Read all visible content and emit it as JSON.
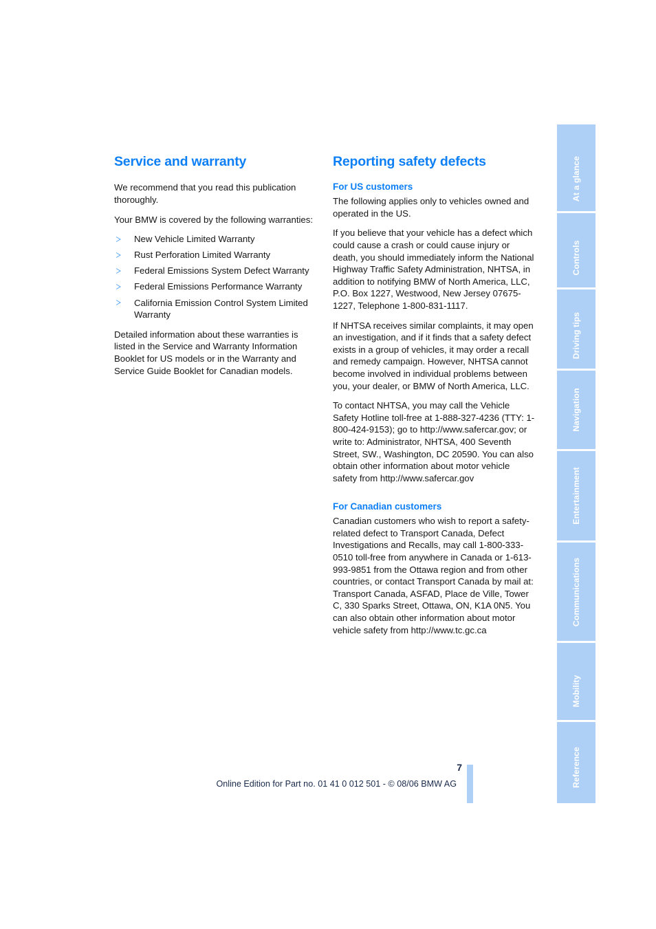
{
  "left_column": {
    "title": "Service and warranty",
    "paragraphs_before_list": [
      "We recommend that you read this publication thoroughly.",
      "Your BMW is covered by the following warranties:"
    ],
    "warranty_list": [
      "New Vehicle Limited Warranty",
      "Rust Perforation Limited Warranty",
      "Federal Emissions System Defect Warranty",
      "Federal Emissions Performance Warranty",
      "California Emission Control System Limited Warranty"
    ],
    "paragraph_after_list": "Detailed information about these warranties is listed in the Service and Warranty Information Booklet for US models or in the Warranty and Service Guide Booklet for Canadian models."
  },
  "right_column": {
    "title": "Reporting safety defects",
    "us_section": {
      "heading": "For US customers",
      "paragraphs": [
        "The following applies only to vehicles owned and operated in the US.",
        "If you believe that your vehicle has a defect which could cause a crash or could cause injury or death, you should immediately inform the National Highway Traffic Safety Administration, NHTSA, in addition to notifying BMW of North America, LLC, P.O. Box 1227, Westwood, New Jersey 07675-1227, Telephone 1-800-831-1117.",
        "If NHTSA receives similar complaints, it may open an investigation, and if it finds that a safety defect exists in a group of vehicles, it may order a recall and remedy campaign. However, NHTSA cannot become involved in individual problems between you, your dealer, or BMW of North America, LLC.",
        "To contact NHTSA, you may call the Vehicle Safety Hotline toll-free at 1-888-327-4236 (TTY: 1-800-424-9153); go to http://www.safercar.gov; or write to: Administrator, NHTSA, 400 Seventh Street, SW., Washington, DC 20590. You can also obtain other information about motor vehicle safety from http://www.safercar.gov"
      ]
    },
    "canada_section": {
      "heading": "For Canadian customers",
      "paragraphs": [
        "Canadian customers who wish to report a safety-related defect to Transport Canada, Defect Investigations and Recalls, may call 1-800-333-0510 toll-free from anywhere in Canada or 1-613-993-9851 from the Ottawa region and from other countries, or contact Transport Canada by mail at: Transport Canada, ASFAD, Place de Ville, Tower C, 330 Sparks Street, Ottawa, ON, K1A 0N5. You can also obtain other information about motor vehicle safety from http://www.tc.gc.ca"
      ]
    }
  },
  "side_tabs": [
    {
      "label": "At a glance"
    },
    {
      "label": "Controls"
    },
    {
      "label": "Driving tips"
    },
    {
      "label": "Navigation"
    },
    {
      "label": "Entertainment"
    },
    {
      "label": "Communications"
    },
    {
      "label": "Mobility"
    },
    {
      "label": "Reference"
    }
  ],
  "footer": {
    "page_number": "7",
    "note": "Online Edition for Part no. 01 41 0 012 501 - © 08/06 BMW AG"
  },
  "colors": {
    "heading_blue": "#0d7ff5",
    "tab_blue": "#aed0f7",
    "bullet_blue": "#5aa7f5",
    "footer_text": "#1a2a4a"
  }
}
